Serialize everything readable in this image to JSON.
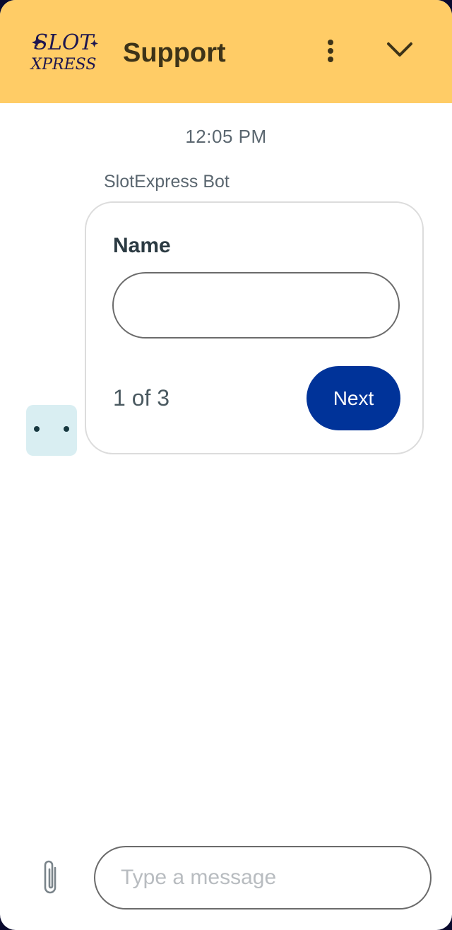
{
  "header": {
    "logo_text_top": "SLOT",
    "logo_text_bottom": "XPRESS",
    "title": "Support",
    "menu_icon": "more-vertical-icon",
    "collapse_icon": "chevron-down-icon",
    "background_color": "#ffcc66"
  },
  "conversation": {
    "timestamp": "12:05 PM",
    "sender_name": "SlotExpress Bot",
    "form_card": {
      "field_label": "Name",
      "field_value": "",
      "pager_text": "1 of 3",
      "next_label": "Next",
      "accent_color": "#003399"
    },
    "bot_avatar_icon": "bot-face-icon"
  },
  "composer": {
    "attach_icon": "paperclip-icon",
    "placeholder": "Type a message",
    "value": ""
  }
}
